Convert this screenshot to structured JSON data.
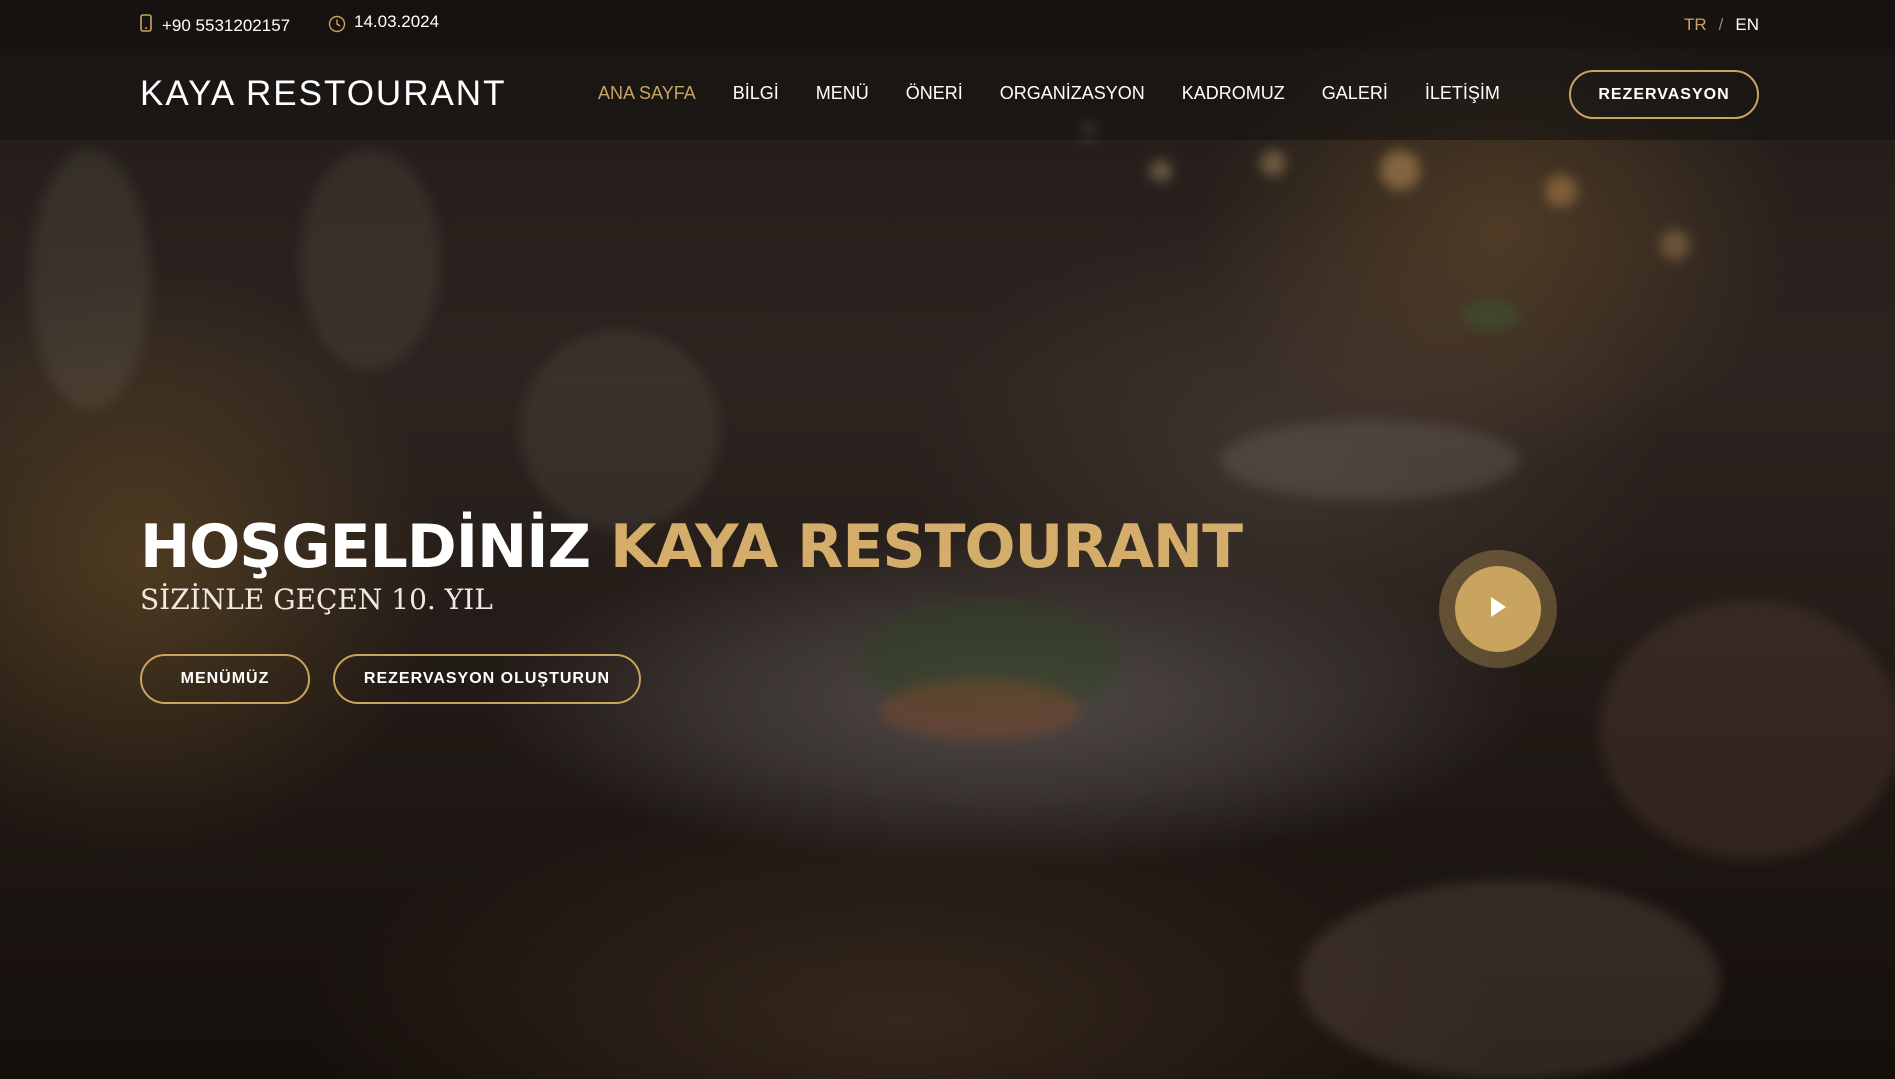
{
  "topbar": {
    "phone": "+90 5531202157",
    "phone_icon": "mobile-phone-icon",
    "date": "14.03.2024",
    "date_icon": "clock-icon",
    "lang_tr": "TR",
    "lang_separator": "/",
    "lang_en": "EN",
    "active_language": "TR"
  },
  "header": {
    "brand": "KAYA RESTOURANT",
    "nav_items": [
      {
        "label": "ANA SAYFA",
        "active": true
      },
      {
        "label": "BİLGİ",
        "active": false
      },
      {
        "label": "MENÜ",
        "active": false
      },
      {
        "label": "ÖNERİ",
        "active": false
      },
      {
        "label": "ORGANİZASYON",
        "active": false
      },
      {
        "label": "KADROMUZ",
        "active": false
      },
      {
        "label": "GALERİ",
        "active": false
      },
      {
        "label": "İLETİŞİM",
        "active": false
      }
    ],
    "reservation_button": "REZERVASYON"
  },
  "hero": {
    "headline_white": "HOŞGELDİNİZ",
    "headline_gold": "KAYA RESTOURANT",
    "subheadline": "SİZİNLE GEÇEN 10. YIL",
    "menu_button": "MENÜMÜZ",
    "reservation_button": "REZERVASYON OLUŞTURUN",
    "play_icon": "play-icon"
  },
  "colors": {
    "accent": "#c9a45f",
    "headline_accent": "#d4ad6a",
    "text": "#ffffff"
  }
}
